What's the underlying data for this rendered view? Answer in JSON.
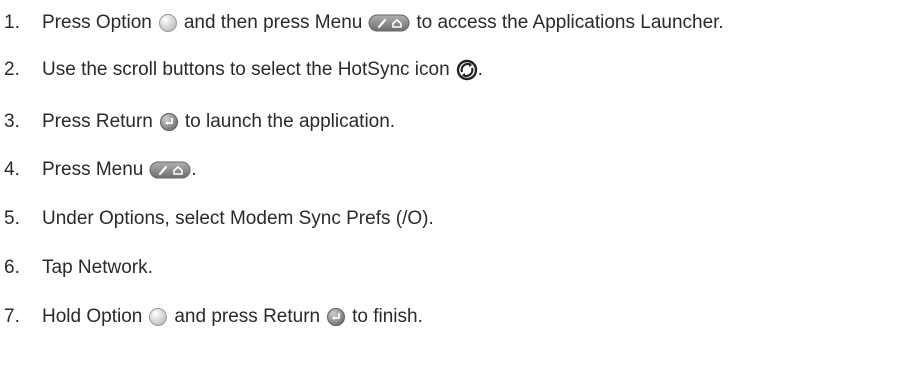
{
  "steps": [
    {
      "num": "1.",
      "a": "Press Option",
      "b": "and then press Menu",
      "c": "to access the Applications Launcher."
    },
    {
      "num": "2.",
      "a": "Use the scroll buttons to select the HotSync icon",
      "b": "."
    },
    {
      "num": "3.",
      "a": "Press Return",
      "b": "to launch the application."
    },
    {
      "num": "4.",
      "a": "Press Menu",
      "b": "."
    },
    {
      "num": "5.",
      "a": "Under Options, select Modem Sync Prefs (/O)."
    },
    {
      "num": "6.",
      "a": "Tap Network."
    },
    {
      "num": "7.",
      "a": "Hold Option",
      "b": "and press Return",
      "c": "to finish."
    }
  ]
}
